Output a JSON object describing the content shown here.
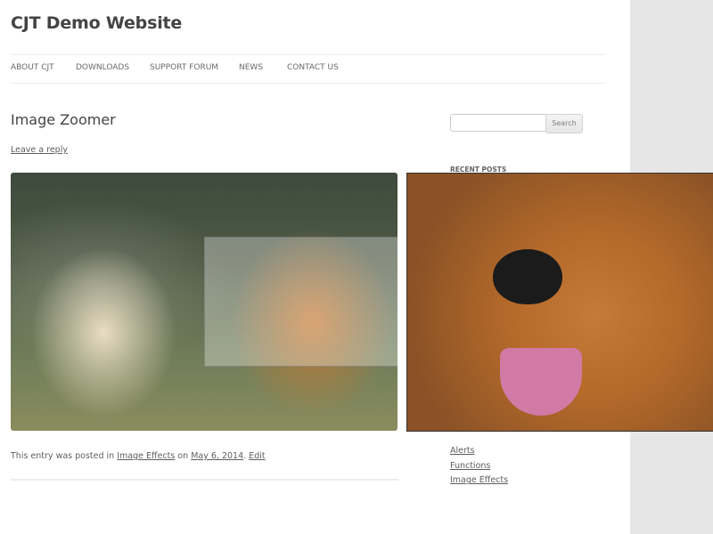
{
  "site": {
    "title": "CJT Demo Website"
  },
  "nav": {
    "items": [
      {
        "label": "ABOUT CJT"
      },
      {
        "label": "DOWNLOADS"
      },
      {
        "label": "SUPPORT FORUM"
      },
      {
        "label": "NEWS"
      },
      {
        "label": "CONTACT US"
      }
    ]
  },
  "post": {
    "title": "Image Zoomer",
    "reply_link": "Leave a reply",
    "meta": {
      "prefix": "This entry was posted in",
      "category": "Image Effects",
      "on": "on",
      "date": "May 6, 2014",
      "sep": ".",
      "edit": "Edit"
    }
  },
  "sidebar": {
    "search": {
      "value": "",
      "button": "Search"
    },
    "recent_posts_title": "RECENT POSTS",
    "categories": [
      {
        "label": "Alerts"
      },
      {
        "label": "Functions"
      },
      {
        "label": "Image Effects"
      }
    ]
  }
}
